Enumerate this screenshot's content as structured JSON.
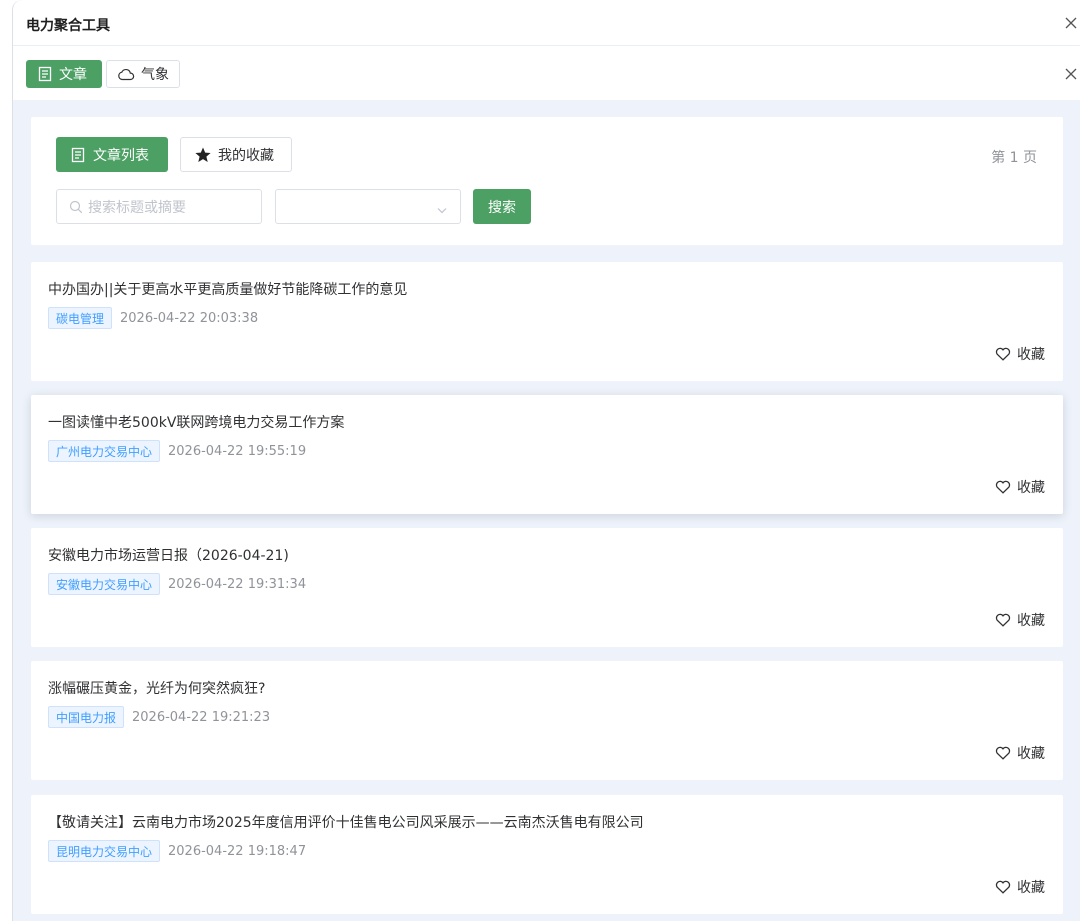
{
  "window": {
    "title": "电力聚合工具"
  },
  "tabs": [
    {
      "label": "文章",
      "icon": "document-icon",
      "active": true
    },
    {
      "label": "气象",
      "icon": "cloud-icon",
      "active": false
    }
  ],
  "toolbar": {
    "article_list_label": "文章列表",
    "favorites_label": "我的收藏",
    "page_indicator": "第 1 页",
    "search_placeholder": "搜索标题或摘要",
    "search_button": "搜索",
    "source_select_value": ""
  },
  "articles": [
    {
      "title": "中办国办||关于更高水平更高质量做好节能降碳工作的意见",
      "source": "碳电管理",
      "time": "2026-04-22 20:03:38",
      "fav_label": "收藏"
    },
    {
      "title": "一图读懂中老500kV联网跨境电力交易工作方案",
      "source": "广州电力交易中心",
      "time": "2026-04-22 19:55:19",
      "fav_label": "收藏"
    },
    {
      "title": "安徽电力市场运营日报（2026-04-21)",
      "source": "安徽电力交易中心",
      "time": "2026-04-22 19:31:34",
      "fav_label": "收藏"
    },
    {
      "title": "涨幅碾压黄金，光纤为何突然疯狂?",
      "source": "中国电力报",
      "time": "2026-04-22 19:21:23",
      "fav_label": "收藏"
    },
    {
      "title": "【敬请关注】云南电力市场2025年度信用评价十佳售电公司风采展示——云南杰沃售电有限公司",
      "source": "昆明电力交易中心",
      "time": "2026-04-22 19:18:47",
      "fav_label": "收藏"
    }
  ],
  "colors": {
    "accent": "#4ca064",
    "tag_text": "#409eff",
    "tag_bg": "#ecf4ff",
    "content_bg": "#eef3fb"
  }
}
